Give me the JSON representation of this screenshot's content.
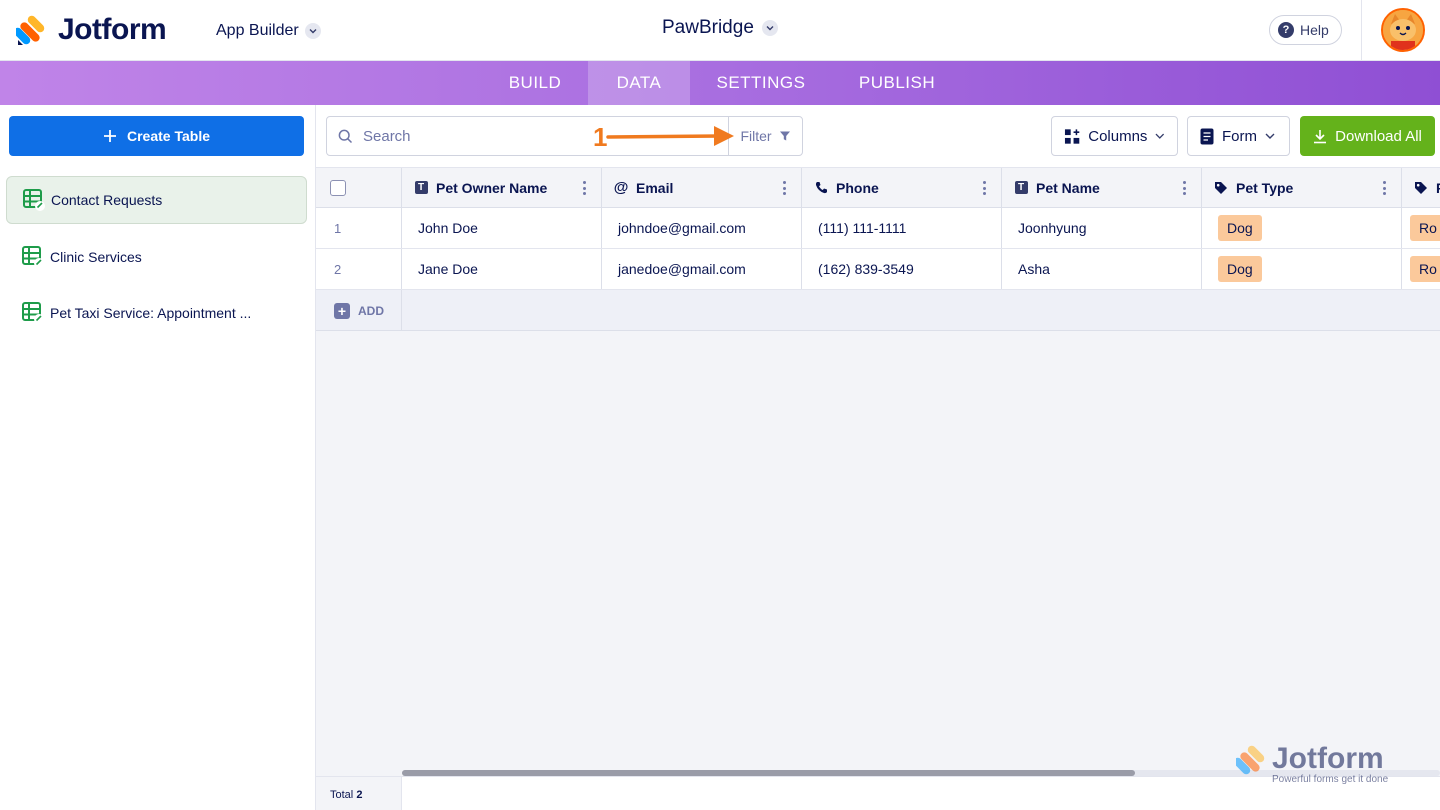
{
  "header": {
    "brand": "Jotform",
    "app_builder_label": "App Builder",
    "app_title": "PawBridge",
    "help_label": "Help"
  },
  "nav": {
    "tabs": [
      {
        "label": "BUILD"
      },
      {
        "label": "DATA"
      },
      {
        "label": "SETTINGS"
      },
      {
        "label": "PUBLISH"
      }
    ],
    "active_tab": "DATA"
  },
  "sidebar": {
    "create_label": "Create Table",
    "items": [
      {
        "label": "Contact Requests"
      },
      {
        "label": "Clinic Services"
      },
      {
        "label": "Pet Taxi Service: Appointment ..."
      }
    ]
  },
  "toolbar": {
    "search_placeholder": "Search",
    "search_value": "",
    "filter_label": "Filter",
    "columns_label": "Columns",
    "form_label": "Form",
    "download_label": "Download All"
  },
  "annotation": {
    "number": "1"
  },
  "table": {
    "columns": [
      {
        "label": "Pet Owner Name",
        "icon": "text-type-icon"
      },
      {
        "label": "Email",
        "icon": "at-sign-icon"
      },
      {
        "label": "Phone",
        "icon": "phone-icon"
      },
      {
        "label": "Pet Name",
        "icon": "text-type-icon"
      },
      {
        "label": "Pet Type",
        "icon": "tag-icon"
      },
      {
        "label": "R",
        "icon": "tag-icon"
      }
    ],
    "rows": [
      {
        "num": "1",
        "owner": "John Doe",
        "email": "johndoe@gmail.com",
        "phone": "(111) 111-1111",
        "pet_name": "Joonhyung",
        "pet_type": "Dog",
        "next": "Ro"
      },
      {
        "num": "2",
        "owner": "Jane Doe",
        "email": "janedoe@gmail.com",
        "phone": "(162) 839-3549",
        "pet_name": "Asha",
        "pet_type": "Dog",
        "next": "Ro"
      }
    ],
    "add_label": "ADD",
    "total_label": "Total",
    "total_count": "2"
  },
  "watermark": {
    "brand": "Jotform",
    "tagline": "Powerful forms get it done"
  },
  "colors": {
    "primary_blue": "#0f6fe6",
    "download_green": "#64b21b",
    "tag_orange": "#fbc99b",
    "annotation_orange": "#f07a1f",
    "nav_purple": "#a86ee0"
  }
}
